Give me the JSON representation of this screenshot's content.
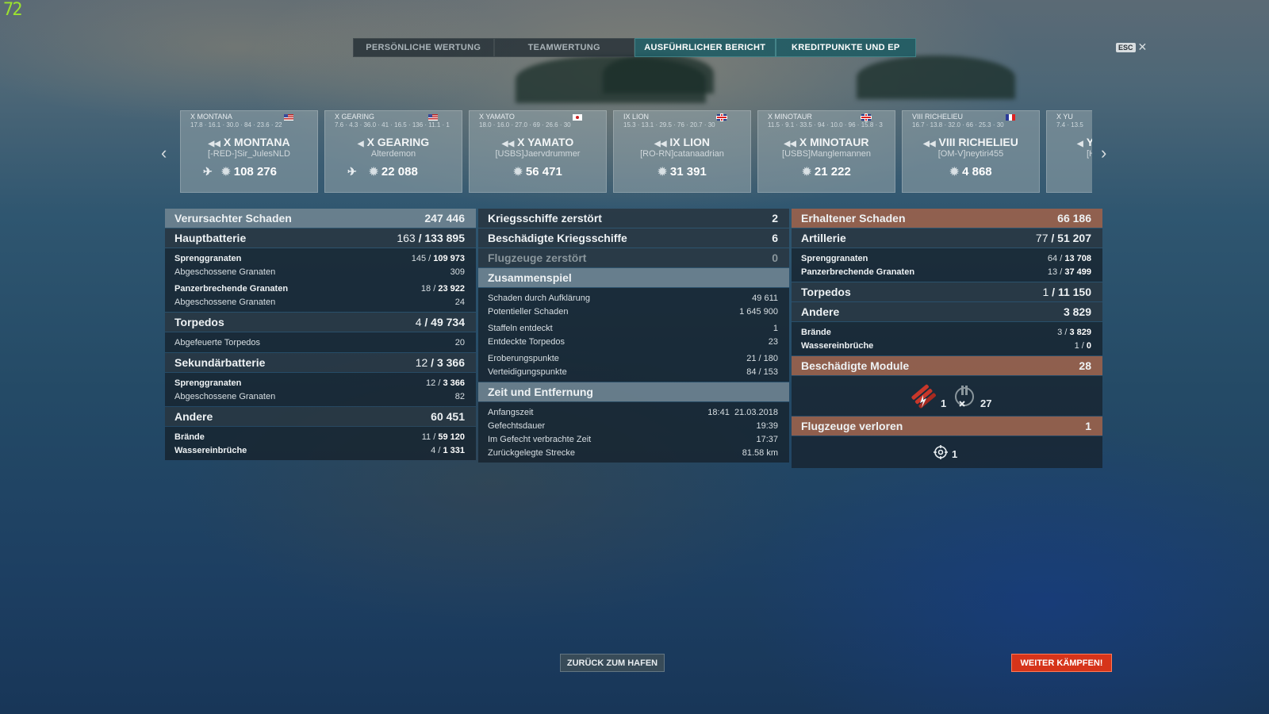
{
  "fps": "72",
  "tabs": [
    {
      "label": "PERSÖNLICHE WERTUNG"
    },
    {
      "label": "TEAMWERTUNG"
    },
    {
      "label": "AUSFÜHRLICHER BERICHT"
    },
    {
      "label": "KREDITPUNKTE UND EP"
    }
  ],
  "active_tab": "AUSFÜHRLICHER BERICHT",
  "esc": {
    "key": "ESC",
    "close": "✕"
  },
  "carousel": {
    "prev": "‹",
    "next": "›",
    "cards": [
      {
        "tier_name": "X MONTANA",
        "stats": "17.8 · 16.1 · 30.0 · 84 · 23.6 · 22",
        "name": "X MONTANA",
        "player": "[-RED-]Sir_JulesNLD",
        "damage": "108 276",
        "flag": "us"
      },
      {
        "tier_name": "X GEARING",
        "stats": "7.6 · 4.3 · 36.0 · 41 · 16.5 · 136 · 11.1 · 1",
        "name": "X GEARING",
        "player": "Alterdemon",
        "damage": "22 088",
        "flag": "us"
      },
      {
        "tier_name": "X YAMATO",
        "stats": "18.0 · 16.0 · 27.0 · 69 · 26.6 · 30",
        "name": "X YAMATO",
        "player": "[USBS]Jaervdrummer",
        "damage": "56 471",
        "flag": "jp"
      },
      {
        "tier_name": "IX LION",
        "stats": "15.3 · 13.1 · 29.5 · 76 · 20.7 · 30",
        "name": "IX LION",
        "player": "[RO-RN]catanaadrian",
        "damage": "31 391",
        "flag": "uk"
      },
      {
        "tier_name": "X MINOTAUR",
        "stats": "11.5 · 9.1 · 33.5 · 94 · 10.0 · 96 · 15.8 · 3",
        "name": "X MINOTAUR",
        "player": "[USBS]Manglemannen",
        "damage": "21 222",
        "flag": "uk"
      },
      {
        "tier_name": "VIII RICHELIEU",
        "stats": "16.7 · 13.8 · 32.0 · 66 · 25.3 · 30",
        "name": "VIII RICHELIEU",
        "player": "[OM-V]neytiri455",
        "damage": "4 868",
        "flag": "fr"
      },
      {
        "tier_name": "X YU",
        "stats": "7.4 · 13.5",
        "name": "Y",
        "player": "[HF",
        "damage": "",
        "flag": "us"
      }
    ]
  },
  "left_panel": {
    "header": {
      "label": "Verursachter Schaden",
      "value": "247 446"
    },
    "main_battery": {
      "label": "Hauptbatterie",
      "hits": "163",
      "value": "133 895"
    },
    "he": {
      "label": "Sprenggranaten",
      "hits": "145",
      "value": "109 973"
    },
    "he_fired": {
      "label": "Abgeschossene Granaten",
      "value": "309"
    },
    "ap": {
      "label": "Panzerbrechende Granaten",
      "hits": "18",
      "value": "23 922"
    },
    "ap_fired": {
      "label": "Abgeschossene Granaten",
      "value": "24"
    },
    "torpedos": {
      "label": "Torpedos",
      "hits": "4",
      "value": "49 734"
    },
    "torp_fired": {
      "label": "Abgefeuerte Torpedos",
      "value": "20"
    },
    "secondary": {
      "label": "Sekundärbatterie",
      "hits": "12",
      "value": "3 366"
    },
    "sec_he": {
      "label": "Sprenggranaten",
      "hits": "12",
      "value": "3 366"
    },
    "sec_fired": {
      "label": "Abgeschossene Granaten",
      "value": "82"
    },
    "other": {
      "label": "Andere",
      "value": "60 451"
    },
    "fires": {
      "label": "Brände",
      "hits": "11",
      "value": "59 120"
    },
    "flooding": {
      "label": "Wassereinbrüche",
      "hits": "4",
      "value": "1 331"
    }
  },
  "middle_panel": {
    "ships_destroyed": {
      "label": "Kriegsschiffe zerstört",
      "value": "2"
    },
    "ships_damaged": {
      "label": "Beschädigte Kriegsschiffe",
      "value": "6"
    },
    "planes_destroyed": {
      "label": "Flugzeuge zerstört",
      "value": "0"
    },
    "teamplay": {
      "label": "Zusammenspiel"
    },
    "spotting": {
      "label": "Schaden durch Aufklärung",
      "value": "49 611"
    },
    "potential": {
      "label": "Potentieller Schaden",
      "value": "1 645 900"
    },
    "squadrons": {
      "label": "Staffeln entdeckt",
      "value": "1"
    },
    "torps_spotted": {
      "label": "Entdeckte Torpedos",
      "value": "23"
    },
    "capture": {
      "label": "Eroberungspunkte",
      "value": "21 / 180"
    },
    "defense": {
      "label": "Verteidigungspunkte",
      "value": "84 / 153"
    },
    "time": {
      "label": "Zeit und Entfernung"
    },
    "start": {
      "label": "Anfangszeit",
      "time": "18:41",
      "date": "21.03.2018"
    },
    "duration": {
      "label": "Gefechtsdauer",
      "value": "19:39"
    },
    "combat_time": {
      "label": "Im Gefecht verbrachte Zeit",
      "value": "17:37"
    },
    "distance": {
      "label": "Zurückgelegte Strecke",
      "value": "81.58 km"
    }
  },
  "right_panel": {
    "header": {
      "label": "Erhaltener Schaden",
      "value": "66 186"
    },
    "artillery": {
      "label": "Artillerie",
      "hits": "77",
      "value": "51 207"
    },
    "he": {
      "label": "Sprenggranaten",
      "hits": "64",
      "value": "13 708"
    },
    "ap": {
      "label": "Panzerbrechende Granaten",
      "hits": "13",
      "value": "37 499"
    },
    "torpedos": {
      "label": "Torpedos",
      "hits": "1",
      "value": "11 150"
    },
    "other": {
      "label": "Andere",
      "value": "3 829"
    },
    "fires": {
      "label": "Brände",
      "hits": "3",
      "value": "3 829"
    },
    "flooding": {
      "label": "Wassereinbrüche",
      "hits": "1",
      "value": "0"
    },
    "modules": {
      "label": "Beschädigte Module",
      "value": "28"
    },
    "module_icons": [
      {
        "icon": "torpedo-tube-icon",
        "count": "1"
      },
      {
        "icon": "turret-icon",
        "count": "27"
      }
    ],
    "planes_lost": {
      "label": "Flugzeuge verloren",
      "value": "1"
    },
    "plane_icon": {
      "icon": "spotter-plane-icon",
      "count": "1"
    }
  },
  "buttons": {
    "port": "ZURÜCK ZUM HAFEN",
    "fight": "WEITER KÄMPFEN!"
  },
  "colors": {
    "accent": "#205c64",
    "damage_header": "#9e624a",
    "fight": "#d6341a"
  }
}
